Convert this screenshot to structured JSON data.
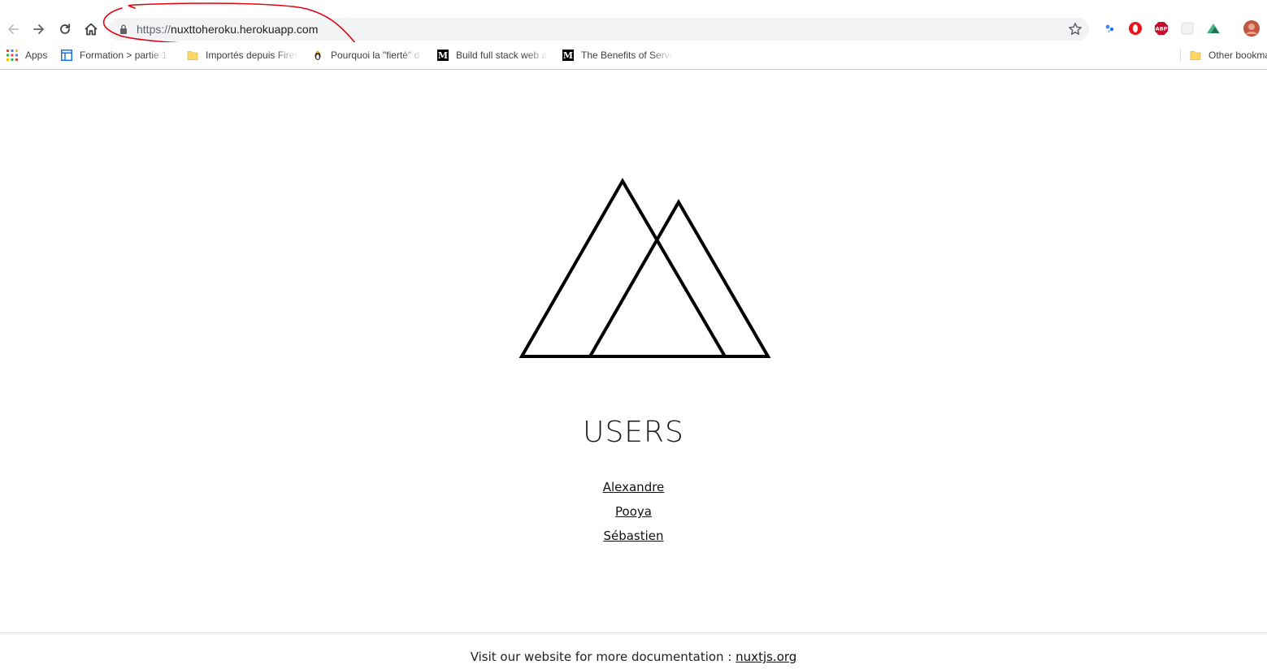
{
  "browser": {
    "address_bar": {
      "scheme": "https://",
      "host": "nuxttoheroku.herokuapp.com"
    },
    "icons": {
      "back": "arrow-left-icon",
      "forward": "arrow-right-icon",
      "reload": "reload-icon",
      "home": "home-icon",
      "lock": "lock-icon",
      "bookmark_star": "star-icon"
    },
    "extensions": [
      "google-translate-icon",
      "opera-icon",
      "adblock-plus-icon",
      "blank-extension-icon",
      "vue-devtools-icon",
      "profile-avatar"
    ],
    "bookmarks": [
      {
        "label": "Apps",
        "icon": "apps-grid-icon"
      },
      {
        "label": "Formation > partie 1",
        "icon": "layout-icon"
      },
      {
        "label": "Importés depuis Firefox",
        "icon": "folder-icon"
      },
      {
        "label": "Pourquoi la \"fierté\" d",
        "icon": "site-favicon"
      },
      {
        "label": "Build full stack web a",
        "icon": "medium-icon"
      },
      {
        "label": "The Benefits of Serve",
        "icon": "medium-icon"
      }
    ],
    "other_bookmarks": {
      "label": "Other bookmarks",
      "icon": "folder-icon"
    },
    "annotation_color": "#e0000f"
  },
  "page": {
    "logo_icon": "nuxt-mountains-logo",
    "title": "USERS",
    "users": [
      "Alexandre",
      "Pooya",
      "Sébastien"
    ],
    "footer": {
      "text": "Visit our website for more documentation :",
      "link_label": "nuxtjs.org"
    }
  }
}
